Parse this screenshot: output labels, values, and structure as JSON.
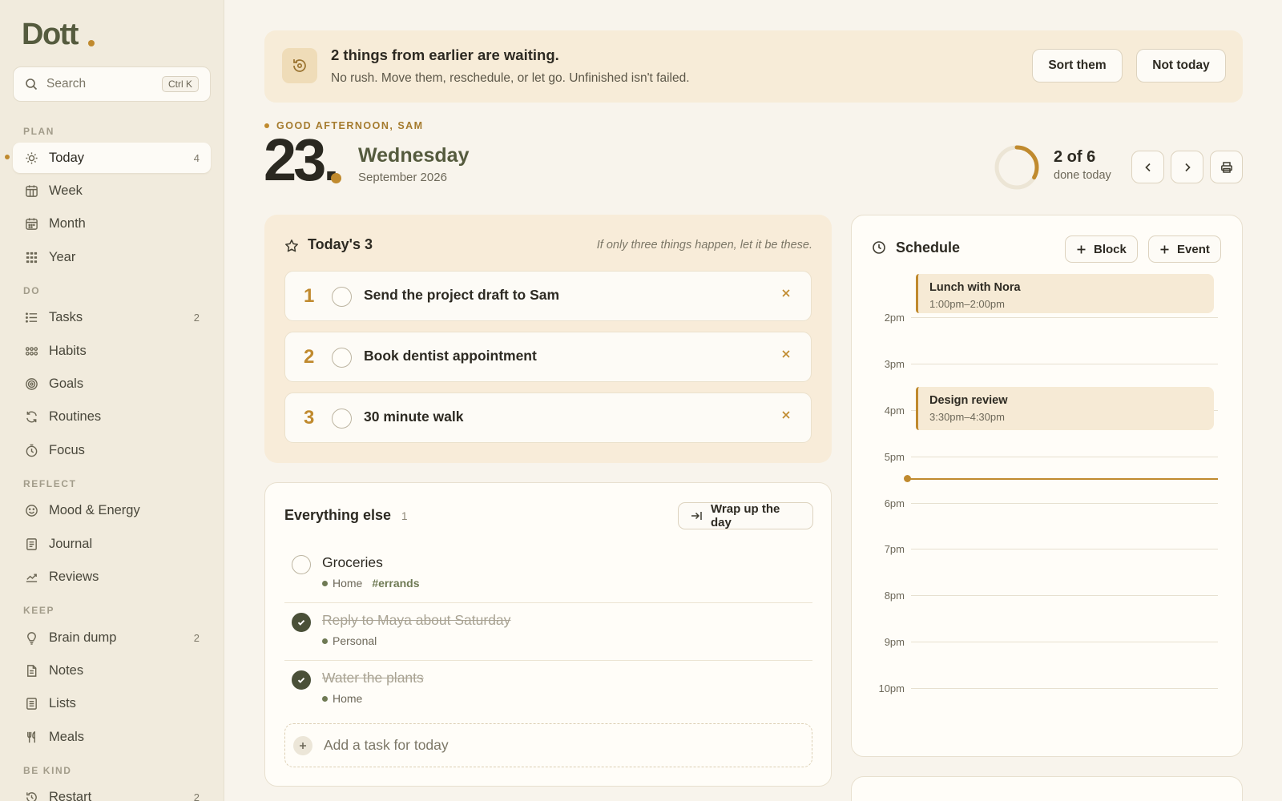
{
  "app": {
    "logo": "Dott",
    "accent_color": "#c08a2e",
    "olive_color": "#555b3e"
  },
  "search": {
    "placeholder": "Search",
    "shortcut": "Ctrl K"
  },
  "sidebar": {
    "sections": [
      {
        "label": "PLAN"
      },
      {
        "label": "DO"
      },
      {
        "label": "REFLECT"
      },
      {
        "label": "KEEP"
      },
      {
        "label": "BE KIND"
      }
    ],
    "items": [
      {
        "label": "Today",
        "count": "4",
        "icon": "sun-icon",
        "active": true
      },
      {
        "label": "Week",
        "count": "",
        "icon": "week-calendar-icon"
      },
      {
        "label": "Month",
        "count": "",
        "icon": "month-calendar-icon"
      },
      {
        "label": "Year",
        "count": "",
        "icon": "year-grid-icon"
      },
      {
        "label": "Tasks",
        "count": "2",
        "icon": "list-icon"
      },
      {
        "label": "Habits",
        "count": "",
        "icon": "habits-dots-icon"
      },
      {
        "label": "Goals",
        "count": "",
        "icon": "target-icon"
      },
      {
        "label": "Routines",
        "count": "",
        "icon": "refresh-icon"
      },
      {
        "label": "Focus",
        "count": "",
        "icon": "timer-icon"
      },
      {
        "label": "Mood & Energy",
        "count": "",
        "icon": "smile-icon"
      },
      {
        "label": "Journal",
        "count": "",
        "icon": "journal-icon"
      },
      {
        "label": "Reviews",
        "count": "",
        "icon": "trend-icon"
      },
      {
        "label": "Brain dump",
        "count": "2",
        "icon": "lightbulb-icon"
      },
      {
        "label": "Notes",
        "count": "",
        "icon": "note-icon"
      },
      {
        "label": "Lists",
        "count": "",
        "icon": "checklist-icon"
      },
      {
        "label": "Meals",
        "count": "",
        "icon": "utensils-icon"
      },
      {
        "label": "Restart",
        "count": "2",
        "icon": "restart-icon"
      }
    ]
  },
  "banner": {
    "title": "2 things from earlier are waiting.",
    "subtitle": "No rush. Move them, reschedule, or let go. Unfinished isn't failed.",
    "icon": "history-icon",
    "primary_label": "Sort them",
    "secondary_label": "Not today"
  },
  "header": {
    "greeting": "GOOD AFTERNOON, SAM",
    "day_number": "23.",
    "weekday": "Wednesday",
    "month_year": "September 2026",
    "progress_text": "2 of 6",
    "progress_sub": "done today",
    "progress_done": 2,
    "progress_total": 6
  },
  "top3": {
    "title": "Today's 3",
    "hint": "If only three things happen, let it be these.",
    "items": [
      {
        "num": "1",
        "text": "Send the project draft to Sam"
      },
      {
        "num": "2",
        "text": "Book dentist appointment"
      },
      {
        "num": "3",
        "text": "30 minute walk"
      }
    ]
  },
  "everything_else": {
    "title": "Everything else",
    "count": "1",
    "wrap_label": "Wrap up the day",
    "tasks": [
      {
        "title": "Groceries",
        "category": "Home",
        "tag": "#errands",
        "done": false
      },
      {
        "title": "Reply to Maya about Saturday",
        "category": "Personal",
        "tag": "",
        "done": true
      },
      {
        "title": "Water the plants",
        "category": "Home",
        "tag": "",
        "done": true
      }
    ],
    "add_placeholder": "Add a task for today"
  },
  "schedule": {
    "title": "Schedule",
    "block_label": "Block",
    "event_label": "Event",
    "hours": [
      "2pm",
      "3pm",
      "4pm",
      "5pm",
      "6pm",
      "7pm",
      "8pm",
      "9pm",
      "10pm"
    ],
    "events": [
      {
        "title": "Lunch with Nora",
        "time": "1:00pm–2:00pm"
      },
      {
        "title": "Design review",
        "time": "3:30pm–4:30pm"
      }
    ]
  }
}
